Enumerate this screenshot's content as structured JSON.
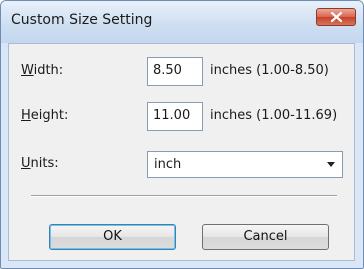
{
  "window": {
    "title": "Custom Size Setting",
    "close_icon": "close-icon"
  },
  "fields": {
    "width": {
      "label_accel": "W",
      "label_rest": "idth:",
      "value": "8.50",
      "hint": "inches (1.00-8.50)"
    },
    "height": {
      "label_accel": "H",
      "label_rest": "eight:",
      "value": "11.00",
      "hint": "inches (1.00-11.69)"
    },
    "units": {
      "label_accel": "U",
      "label_rest": "nits:",
      "selected": "inch",
      "dropdown_icon": "chevron-down-icon"
    }
  },
  "buttons": {
    "ok": "OK",
    "cancel": "Cancel"
  },
  "colors": {
    "titlebar": "#cfdff1",
    "close_button": "#c6422a",
    "panel": "#f0f0f0"
  }
}
